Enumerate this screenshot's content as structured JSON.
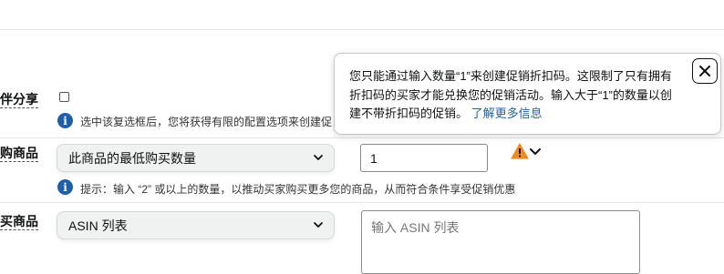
{
  "rows": {
    "share": {
      "label": "伴分享",
      "hint": "选中该复选框后，您将获得有限的配置选项来创建促",
      "checked": false
    },
    "buy": {
      "label": "购商品",
      "select_value": "此商品的最低购买数量",
      "quantity_value": "1",
      "hint": "提示：输入 “2” 或以上的数量，以推动买家购买更多您的商品，从而符合条件享受促销优惠"
    },
    "purchase": {
      "label": "买商品",
      "select_value": "ASIN 列表",
      "textarea_placeholder": "输入 ASIN 列表"
    }
  },
  "popover": {
    "text": "您只能通过输入数量“1”来创建促销折扣码。这限制了只有拥有折扣码的买家才能兑换您的促销活动。输入大于“1”的数量以创建不带折扣码的促销。",
    "link": "了解更多信息"
  },
  "icons": {
    "info": "info-icon",
    "warning": "warning-icon",
    "chevron": "chevron-down-icon",
    "close": "close-icon"
  },
  "colors": {
    "info_blue": "#1f5fa8",
    "warning_orange": "#f08a24",
    "link_blue": "#1c62a8"
  }
}
